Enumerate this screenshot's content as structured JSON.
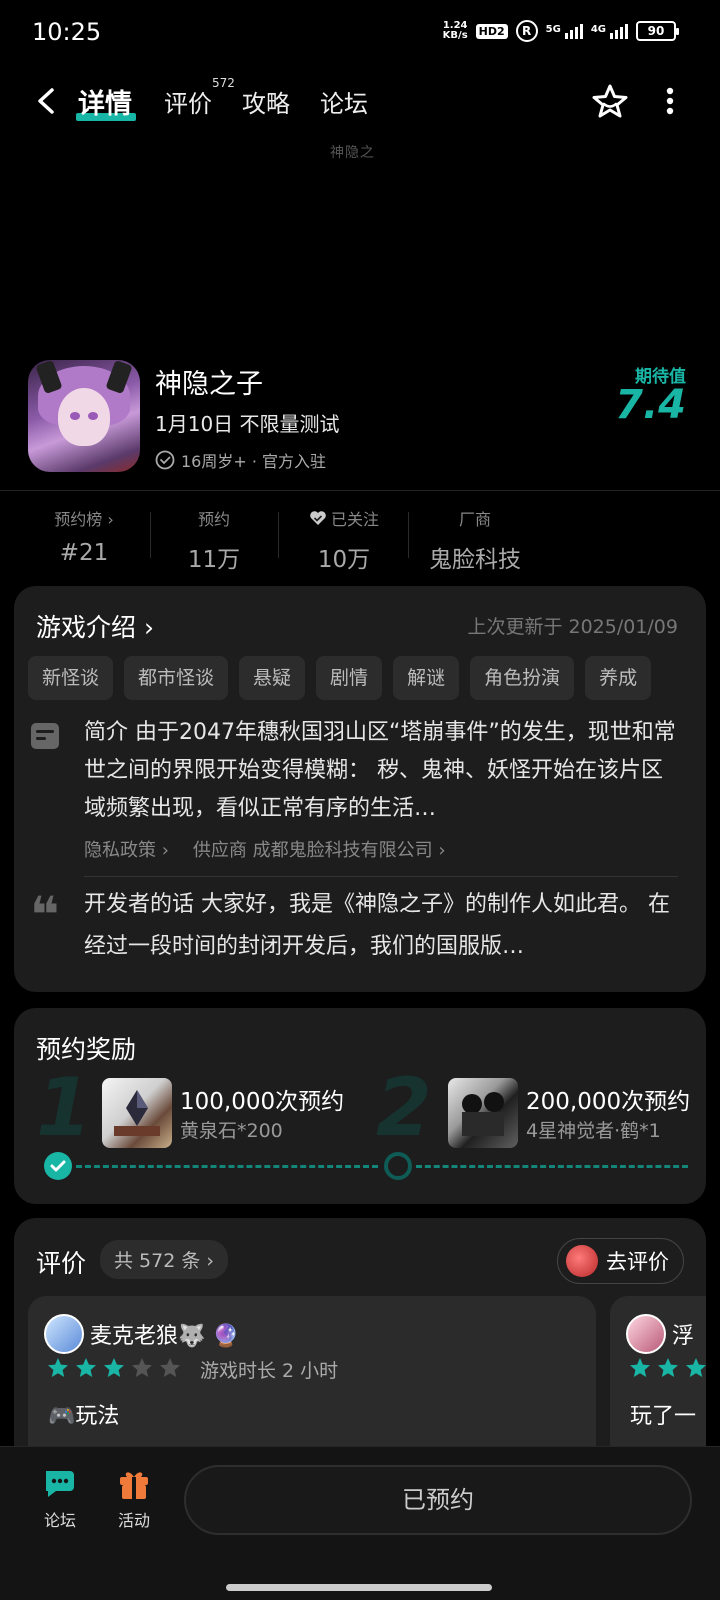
{
  "status": {
    "time": "10:25",
    "speed_value": "1.24",
    "speed_unit": "KB/s",
    "hd": "HD2",
    "r_mark": "R",
    "net1": "5G",
    "net2": "4G",
    "battery": "90"
  },
  "nav": {
    "tabs": [
      "详情",
      "评价",
      "攻略",
      "论坛"
    ],
    "review_badge": "572",
    "icons": [
      "back-icon",
      "favorite-star-icon",
      "more-icon"
    ]
  },
  "banner": {
    "logo_text": "神隐之"
  },
  "game": {
    "title": "神隐之子",
    "subtitle": "1月10日 不限量测试",
    "meta": "16周岁+ · 官方入驻",
    "expectation_label": "期待值",
    "expectation_value": "7.4"
  },
  "stats": [
    {
      "label": "预约榜 ›",
      "value": "#21"
    },
    {
      "label": "预约",
      "value": "11万"
    },
    {
      "label": "已关注",
      "value": "10万"
    },
    {
      "label": "厂商",
      "value": "鬼脸科技"
    }
  ],
  "intro": {
    "title": "游戏介绍 ›",
    "updated": "上次更新于 2025/01/09",
    "tags": [
      "新怪谈",
      "都市怪谈",
      "悬疑",
      "剧情",
      "解谜",
      "角色扮演",
      "养成"
    ],
    "description": "简介 由于2047年穗秋国羽山区“塔崩事件”的发生，现世和常世之间的界限开始变得模糊： 秽、鬼神、妖怪开始在该片区域频繁出现，看似正常有序的生活…",
    "privacy_link": "隐私政策 ›",
    "supplier_link": "供应商 成都鬼脸科技有限公司 ›",
    "developer_note": "开发者的话 大家好，我是《神隐之子》的制作人如此君。 在经过一段时间的封闭开发后，我们的国服版…"
  },
  "rewards": {
    "title": "预约奖励",
    "items": [
      {
        "number": "1",
        "name": "100,000次预约",
        "item": "黄泉石*200"
      },
      {
        "number": "2",
        "name": "200,000次预约",
        "item": "4星神觉者·鹤*1"
      }
    ]
  },
  "reviews": {
    "title": "评价",
    "count": "共 572 条 ›",
    "write_label": "去评价",
    "cards": [
      {
        "user": "麦克老狼🐺 🔮",
        "stars": 3,
        "playtime": "游戏时长 2 小时",
        "category": "🎮玩法"
      },
      {
        "user": "浮",
        "stars": 3,
        "text": "玩了一"
      }
    ]
  },
  "bottom": {
    "forum_label": "论坛",
    "activity_label": "活动",
    "reserved_label": "已预约"
  },
  "colors": {
    "accent": "#19b5a5",
    "background": "#000000",
    "card": "#1d1d1d"
  }
}
